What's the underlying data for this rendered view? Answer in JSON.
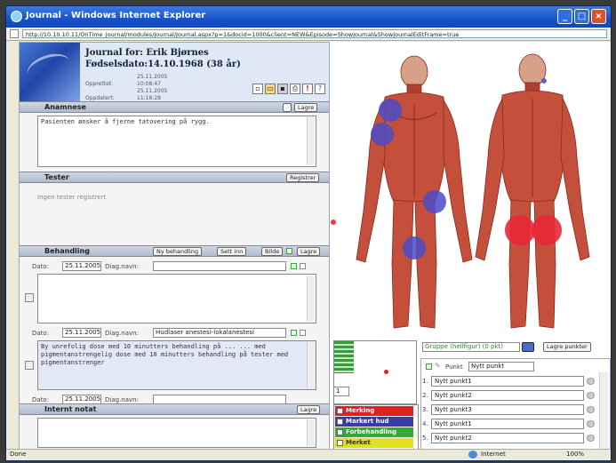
{
  "window": {
    "title": "Journal - Windows Internet Explorer",
    "address": "http://10.10.10.11/OnTime_Journal/modules/Journal/Journal.aspx?p=1&docid=1000&client=NEW&Episode=ShowJournal&ShowJournalEditFrame=true"
  },
  "header": {
    "name": "Journal for: Erik Bjørnes",
    "dob": "Fødselsdato:14.10.1968 (38 år)",
    "meta_rows": [
      {
        "label": "Opprettet:",
        "value": "25.11.2005 10:08:47"
      },
      {
        "label": "Oppdatert:",
        "value": "25.11.2005 11:18:28"
      }
    ]
  },
  "anamnese": {
    "title": "Anamnese",
    "btn": "Lagre",
    "text": "Pasienten ønsker å fjerne tatovering på rygg."
  },
  "tester": {
    "title": "Tester",
    "btn": "Registrer",
    "empty": "Ingen tester registrert"
  },
  "behandling": {
    "title": "Behandling",
    "buttons": [
      "Ny behandling",
      "Sett inn",
      "Bilde",
      "Lagre"
    ],
    "entries": [
      {
        "date_label": "Dato:",
        "date": "25.11.2005",
        "diag_label": "Diag.navn:",
        "diag": "",
        "text": ""
      },
      {
        "date_label": "Dato:",
        "date": "25.11.2005",
        "diag_label": "Diag.navn:",
        "diag": "Hudlaser anestesi-lokalanestesi",
        "text": "By unrefolig dose med 10 minutters behandling på ... ... med pigmentanstrengelig dose med 10 minutters behandling på tester med pigmentanstrenger"
      },
      {
        "date_label": "Dato:",
        "date": "25.11.2005",
        "diag_label": "Diag.navn:",
        "diag": "",
        "text": ""
      }
    ]
  },
  "internt": {
    "title": "Internt notat",
    "btn": "Lagre"
  },
  "bodymap": {
    "group_select": "Gruppe (hellfigur) (0 pkt)",
    "save_btn": "Lagre punkter",
    "mini_value": "1",
    "point_label": "Punkt",
    "point_input": "Nytt punkt",
    "legend": [
      {
        "label": "Merking",
        "color": "#e02020"
      },
      {
        "label": "Markert hud",
        "color": "#3a3aa8"
      },
      {
        "label": "Forbehandling",
        "color": "#33aa33"
      },
      {
        "label": "Merket",
        "color": "#e0e020"
      }
    ],
    "points": [
      {
        "num": "1.",
        "label": "Nytt punkt1"
      },
      {
        "num": "2.",
        "label": "Nytt punkt2"
      },
      {
        "num": "3.",
        "label": "Nytt punkt3"
      },
      {
        "num": "4.",
        "label": "Nytt punkt1"
      },
      {
        "num": "5.",
        "label": "Nytt punkt2"
      }
    ]
  },
  "status": {
    "left": "Done",
    "zone": "Internet",
    "zoom": "100%"
  },
  "colors": {
    "marker_blue": "#4b4bc8",
    "marker_red": "#e8283a"
  }
}
